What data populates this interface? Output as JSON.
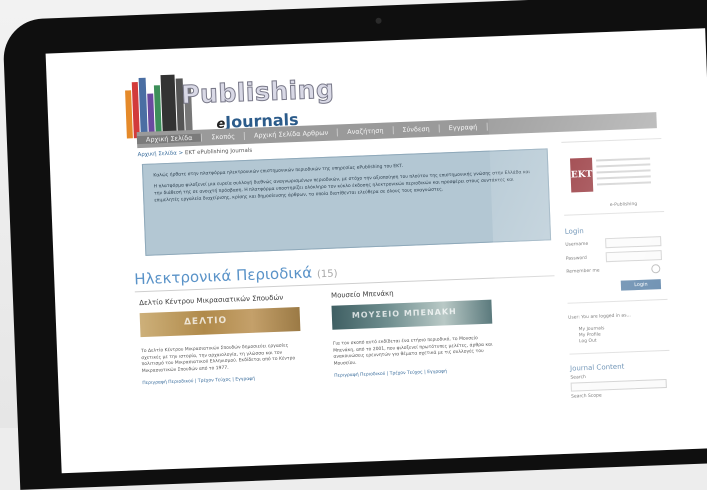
{
  "site": {
    "logo_title": "Publishing",
    "logo_e": "e",
    "logo_sub": "Journals"
  },
  "nav": [
    {
      "label": "Αρχική Σελίδα"
    },
    {
      "label": "Σκοπός"
    },
    {
      "label": "Αρχική Σελίδα Αρθρων"
    },
    {
      "label": "Αναζήτηση"
    },
    {
      "label": "Σύνδεση"
    },
    {
      "label": "Εγγραφή"
    }
  ],
  "breadcrumb": {
    "home": "Αρχική Σελίδα",
    "current": "ΕΚΤ ePublishing Journals"
  },
  "intro": {
    "p1": "Καλώς ήρθατε στην πλατφόρμα ηλεκτρονικών επιστημονικών περιοδικών της υπηρεσίας ePublishing του ΕΚΤ.",
    "p2": "Η πλατφόρμα φιλοξενεί μια ευρεία συλλογή διεθνώς αναγνωρισμένων περιοδικών, με στόχο την αξιοποίηση του πλούτου της επιστημονικής γνώσης στην Ελλάδα και την διάθεσή της σε ανοιχτή πρόσβαση. Η πλατφόρμα υποστηρίζει ολόκληρο τον κύκλο έκδοσης ηλεκτρονικών περιοδικών και προσφέρει στους συντάκτες και επιμελητές εργαλεία διαχείρισης, κρίσης και δημοσίευσης άρθρων, τα οποία διατίθενται ελεύθερα σε όλους τους αναγνώστες."
  },
  "section": {
    "title": "Ηλεκτρονικά Περιοδικά",
    "count": "(15)"
  },
  "journals": [
    {
      "title": "Δελτίο Κέντρου Μικρασιατικών Σπουδών",
      "banner": "ΔΕΛΤΙΟ",
      "body": "Το Δελτίο Κέντρου Μικρασιατικών Σπουδών δημοσιεύει εργασίες σχετικές με την ιστορία, την αρχαιολογία, τη γλώσσα και τον πολιτισμό του Μικρασιατικού Ελληνισμού. Εκδίδεται από το Κέντρο Μικρασιατικών Σπουδών από το 1977.",
      "links": [
        "Περιγραφή Περιοδικού",
        "Τρέχον Τεύχος",
        "Εγγραφή"
      ]
    },
    {
      "title": "Μουσείο Μπενάκη",
      "banner": "ΜΟΥΣΕΙΟ ΜΠΕΝΑΚΗ",
      "body": "Για τον σκοπό αυτό εκδίδεται ένα ετήσιο περιοδικό, το Μουσείο Μπενάκη, από το 2001, που φιλοξενεί πρωτότυπες μελέτες, άρθρα και ανακοινώσεις ερευνητών για θέματα σχετικά με τις συλλογές του Μουσείου.",
      "links": [
        "Περιγραφή Περιοδικού",
        "Τρέχον Τεύχος",
        "Εγγραφή"
      ]
    }
  ],
  "sidebar": {
    "eap_logo": "ΕΚΤ",
    "eap_text": "e-Publishing",
    "login_title": "Login",
    "username_label": "Username",
    "password_label": "Password",
    "remember_label": "Remember me",
    "login_button": "Login",
    "side_text": "User: You are logged in as...",
    "side_list": [
      "My Journals",
      "My Profile",
      "Log Out"
    ],
    "jc_title": "Journal Content",
    "jc_search_label": "Search",
    "jc_scope_label": "Search Scope"
  }
}
